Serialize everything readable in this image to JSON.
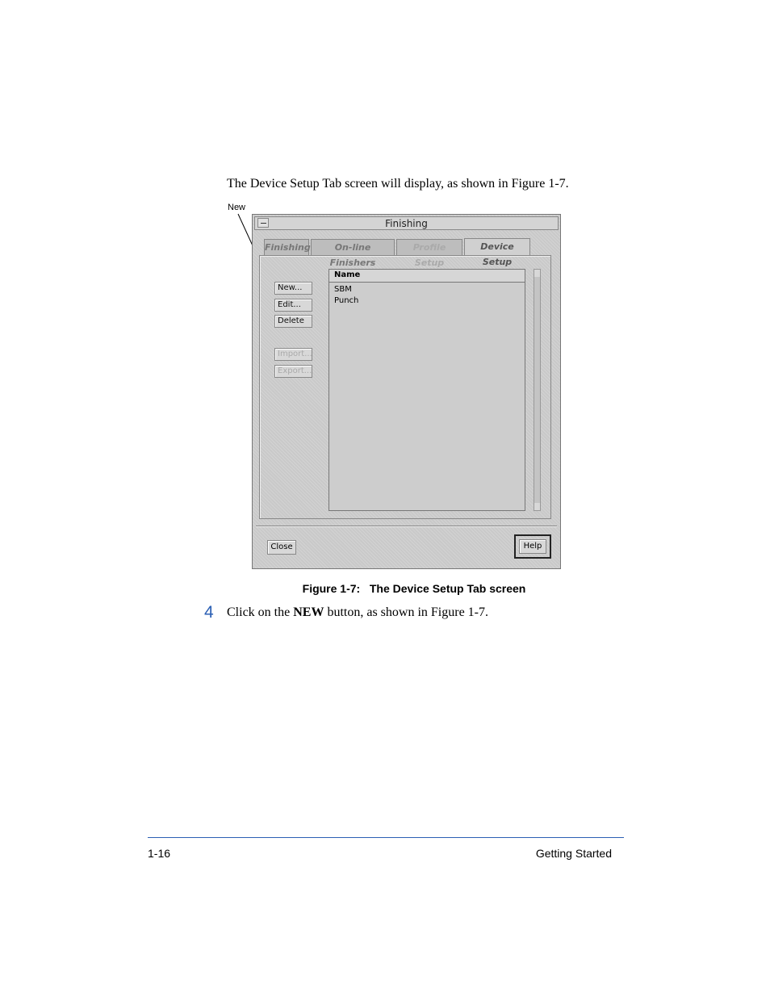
{
  "intro_text": "The Device Setup Tab screen will display, as shown in Figure 1-7.",
  "callout_label": "New",
  "window": {
    "title": "Finishing",
    "tabs": [
      {
        "label": "Finishing",
        "state": "inactive"
      },
      {
        "label": "On-line Finishers",
        "state": "inactive"
      },
      {
        "label": "Profile Setup",
        "state": "disabled"
      },
      {
        "label": "Device Setup",
        "state": "active"
      }
    ],
    "buttons": {
      "new": "New...",
      "edit": "Edit...",
      "delete": "Delete",
      "import": "Import...",
      "export": "Export..."
    },
    "list": {
      "header": "Name",
      "items": [
        "SBM",
        "Punch"
      ]
    },
    "close_label": "Close",
    "help_label": "Help"
  },
  "caption": "Figure 1-7:   The Device Setup Tab screen",
  "step": {
    "number": "4",
    "text_before": "Click on the ",
    "text_bold": "NEW",
    "text_after": " button, as shown in Figure 1-7."
  },
  "footer": {
    "page_number": "1-16",
    "section": "Getting Started"
  },
  "colors": {
    "accent": "#2b5fb4",
    "window_bg": "#c9c9c9"
  }
}
